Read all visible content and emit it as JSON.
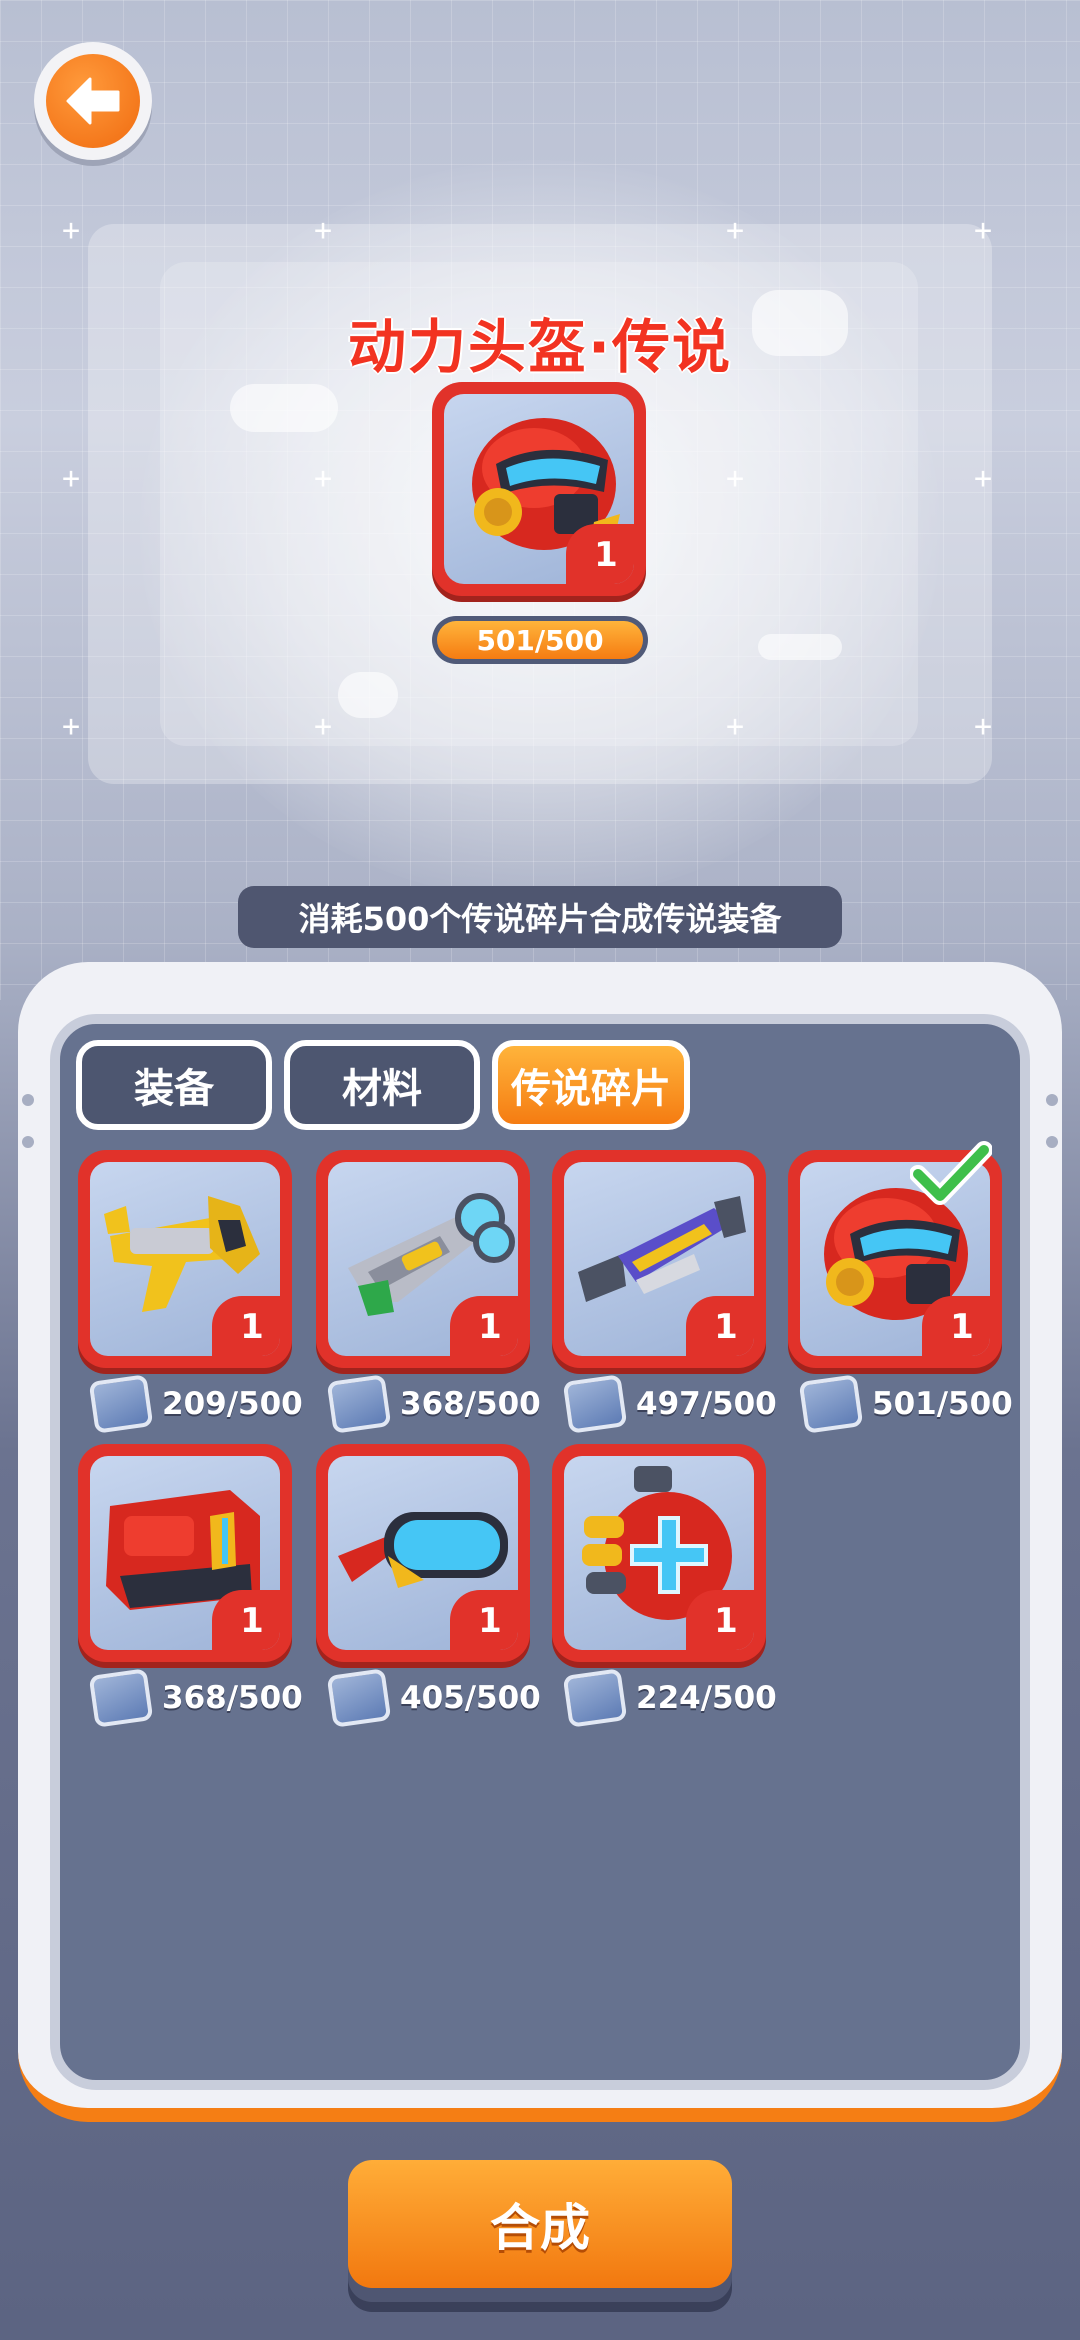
{
  "header": {
    "back_icon": "arrow-left-icon"
  },
  "featured": {
    "title": "动力头盔·传说",
    "count": "1",
    "progress_text": "501/500",
    "progress_fraction": 1.0,
    "item_icon": "red-helmet-icon"
  },
  "description": "消耗500个传说碎片合成传说装备",
  "tabs": [
    {
      "label": "装备",
      "active": false
    },
    {
      "label": "材料",
      "active": false
    },
    {
      "label": "传说碎片",
      "active": true
    }
  ],
  "items": [
    {
      "name": "golden-pistol",
      "count": "1",
      "fragments": "209/500",
      "selected": false
    },
    {
      "name": "plasma-blaster",
      "count": "1",
      "fragments": "368/500",
      "selected": false
    },
    {
      "name": "purple-shotgun",
      "count": "1",
      "fragments": "497/500",
      "selected": false
    },
    {
      "name": "red-helmet",
      "count": "1",
      "fragments": "501/500",
      "selected": true
    },
    {
      "name": "red-armor",
      "count": "1",
      "fragments": "368/500",
      "selected": false
    },
    {
      "name": "blue-goggles",
      "count": "1",
      "fragments": "405/500",
      "selected": false
    },
    {
      "name": "medic-backpack",
      "count": "1",
      "fragments": "224/500",
      "selected": false
    }
  ],
  "actions": {
    "synthesize_label": "合成"
  },
  "colors": {
    "accent_orange": "#f57c12",
    "legend_red": "#e1322a",
    "panel_blue": "#66728f"
  }
}
